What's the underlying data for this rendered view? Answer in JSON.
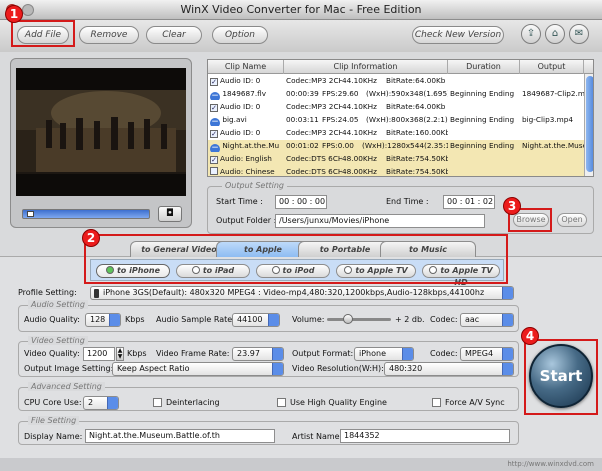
{
  "window": {
    "title": "WinX Video Converter for Mac - Free Edition"
  },
  "toolbar": {
    "add_file": "Add File",
    "remove": "Remove",
    "clear": "Clear",
    "option": "Option",
    "check_version": "Check New Version"
  },
  "table": {
    "headers": [
      "Clip Name",
      "Clip Information",
      "Duration",
      "Output"
    ],
    "rows": [
      {
        "name": "Audio ID: 0",
        "info1": "Codec:MP3 2CH",
        "info2": "44.10KHz",
        "info3": "BitRate:64.00Kb",
        "duration": "",
        "output": ""
      },
      {
        "name": "1849687.flv",
        "info1": "00:00:39",
        "info2": "FPS:29.60",
        "info3": "(WxH):590x348(1.695)",
        "duration": "Beginning Ending",
        "output": "1849687-Clip2.m"
      },
      {
        "name": "Audio ID: 0",
        "info1": "Codec:MP3 2CH",
        "info2": "44.10KHz",
        "info3": "BitRate:64.00Kb",
        "duration": "",
        "output": ""
      },
      {
        "name": "big.avi",
        "info1": "00:03:11",
        "info2": "FPS:24.05",
        "info3": "(WxH):800x368(2.2:1)",
        "duration": "Beginning Ending",
        "output": "big-Clip3.mp4"
      },
      {
        "name": "Audio ID: 0",
        "info1": "Codec:MP3 2CH",
        "info2": "44.10KHz",
        "info3": "BitRate:160.00Kb",
        "duration": "",
        "output": ""
      },
      {
        "name": "Night.at.the.Mu",
        "info1": "00:01:02",
        "info2": "FPS:0.00",
        "info3": "(WxH):1280x544(2.35:1)",
        "duration": "Beginning Ending",
        "output": "Night.at.the.Museu"
      },
      {
        "name": "Audio: English",
        "info1": "Codec:DTS 6CH",
        "info2": "48.00KHz",
        "info3": "BitRate:754.50Kb",
        "duration": "",
        "output": ""
      },
      {
        "name": "Audio: Chinese",
        "info1": "Codec:DTS 6CH",
        "info2": "48.00KHz",
        "info3": "BitRate:754.50Kb",
        "duration": "",
        "output": ""
      }
    ]
  },
  "output_setting": {
    "title": "Output Setting",
    "start_label": "Start Time :",
    "start_value": "00 : 00 : 00",
    "end_label": "End Time :",
    "end_value": "00 : 01 : 02",
    "folder_label": "Output Folder :",
    "folder_value": "/Users/junxu/Movies/iPhone",
    "browse": "Browse",
    "open": "Open"
  },
  "tabs": [
    "to General Video",
    "to Apple",
    "to Portable",
    "to Music"
  ],
  "subtabs": [
    "to iPhone",
    "to iPad",
    "to iPod",
    "to Apple TV",
    "to Apple TV HD"
  ],
  "profile": {
    "label": "Profile Setting:",
    "value": "iPhone 3GS(Default): 480x320 MPEG4 : Video-mp4,480:320,1200kbps,Audio-128kbps,44100hz"
  },
  "audio": {
    "title": "Audio Setting",
    "quality_label": "Audio Quality:",
    "quality_value": "128",
    "quality_unit": "Kbps",
    "rate_label": "Audio Sample Rate:",
    "rate_value": "44100",
    "volume_label": "Volume:",
    "volume_value": "+ 2 db.",
    "codec_label": "Codec:",
    "codec_value": "aac"
  },
  "video": {
    "title": "Video Setting",
    "quality_label": "Video Quality:",
    "quality_value": "1200",
    "quality_unit": "Kbps",
    "framerate_label": "Video Frame Rate:",
    "framerate_value": "23.97",
    "format_label": "Output Format:",
    "format_value": "iPhone",
    "codec_label": "Codec:",
    "codec_value": "MPEG4",
    "image_label": "Output Image Setting:",
    "image_value": "Keep Aspect Ratio",
    "resolution_label": "Video Resolution(W:H):",
    "resolution_value": "480:320"
  },
  "advanced": {
    "title": "Advanced Setting",
    "cpu_label": "CPU Core Use:",
    "cpu_value": "2",
    "deinterlacing": "Deinterlacing",
    "high_quality": "Use High Quality Engine",
    "force_sync": "Force A/V Sync"
  },
  "file_setting": {
    "title": "File Setting",
    "display_label": "Display Name:",
    "display_value": "Night.at.the.Museum.Battle.of.th",
    "artist_label": "Artist Name:",
    "artist_value": "1844352"
  },
  "start_button": "Start",
  "badges": [
    "1",
    "2",
    "3",
    "4"
  ],
  "footer": "http://www.winxdvd.com",
  "colors": {
    "highlight": "#d41a1a",
    "selected_row": "#f3e7b3",
    "accent_blue": "#3d76d7"
  }
}
